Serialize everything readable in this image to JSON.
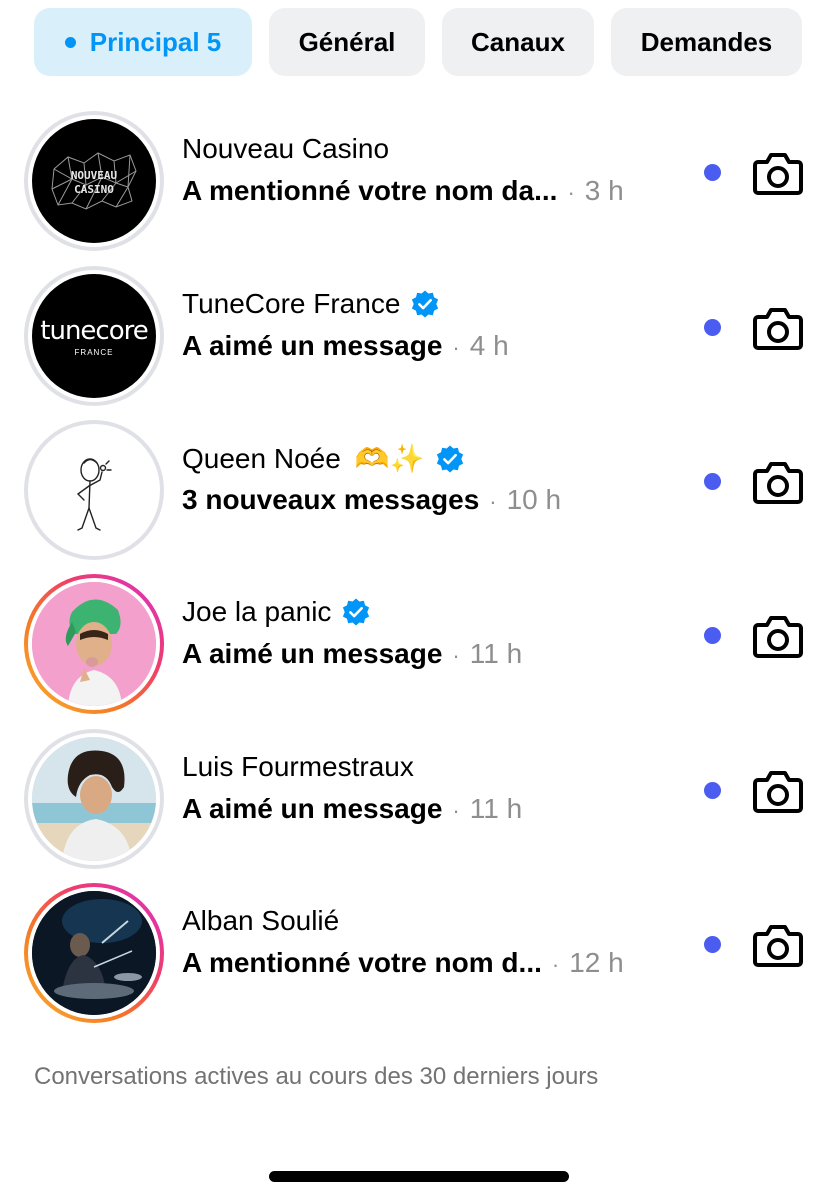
{
  "tabs": [
    {
      "label": "Principal 5",
      "active": true
    },
    {
      "label": "Général",
      "active": false
    },
    {
      "label": "Canaux",
      "active": false
    },
    {
      "label": "Demandes",
      "active": false
    }
  ],
  "conversations": [
    {
      "name": "Nouveau Casino",
      "preview": "A mentionné votre nom da...",
      "separator": "·",
      "time": "3 h",
      "verified": false,
      "unread": true,
      "story_ring": false,
      "avatar_text": "NOUVEAU CASINO"
    },
    {
      "name": "TuneCore France",
      "preview": "A aimé un message",
      "separator": "·",
      "time": "4 h",
      "verified": true,
      "unread": true,
      "story_ring": false,
      "avatar_text": "tunecore",
      "avatar_subtext": "FRANCE"
    },
    {
      "name": "Queen Noée",
      "emoji": "🫶✨",
      "preview": "3 nouveaux messages",
      "separator": "·",
      "time": "10 h",
      "verified": true,
      "unread": true,
      "story_ring": false
    },
    {
      "name": "Joe la panic",
      "preview": "A aimé un message",
      "separator": "·",
      "time": "11 h",
      "verified": true,
      "unread": true,
      "story_ring": true
    },
    {
      "name": "Luis Fourmestraux",
      "preview": "A aimé un message",
      "separator": "·",
      "time": "11 h",
      "verified": false,
      "unread": true,
      "story_ring": false
    },
    {
      "name": "Alban Soulié",
      "preview": "A mentionné votre nom d...",
      "separator": "·",
      "time": "12 h",
      "verified": false,
      "unread": true,
      "story_ring": true
    }
  ],
  "footer_note": "Conversations actives au cours des 30 derniers jours",
  "icons": {
    "verified": "verified-badge-icon",
    "camera": "camera-icon",
    "unread": "unread-dot"
  },
  "colors": {
    "accent": "#0095f6",
    "unread_dot": "#4a5df0",
    "verified": "#0095f6"
  }
}
